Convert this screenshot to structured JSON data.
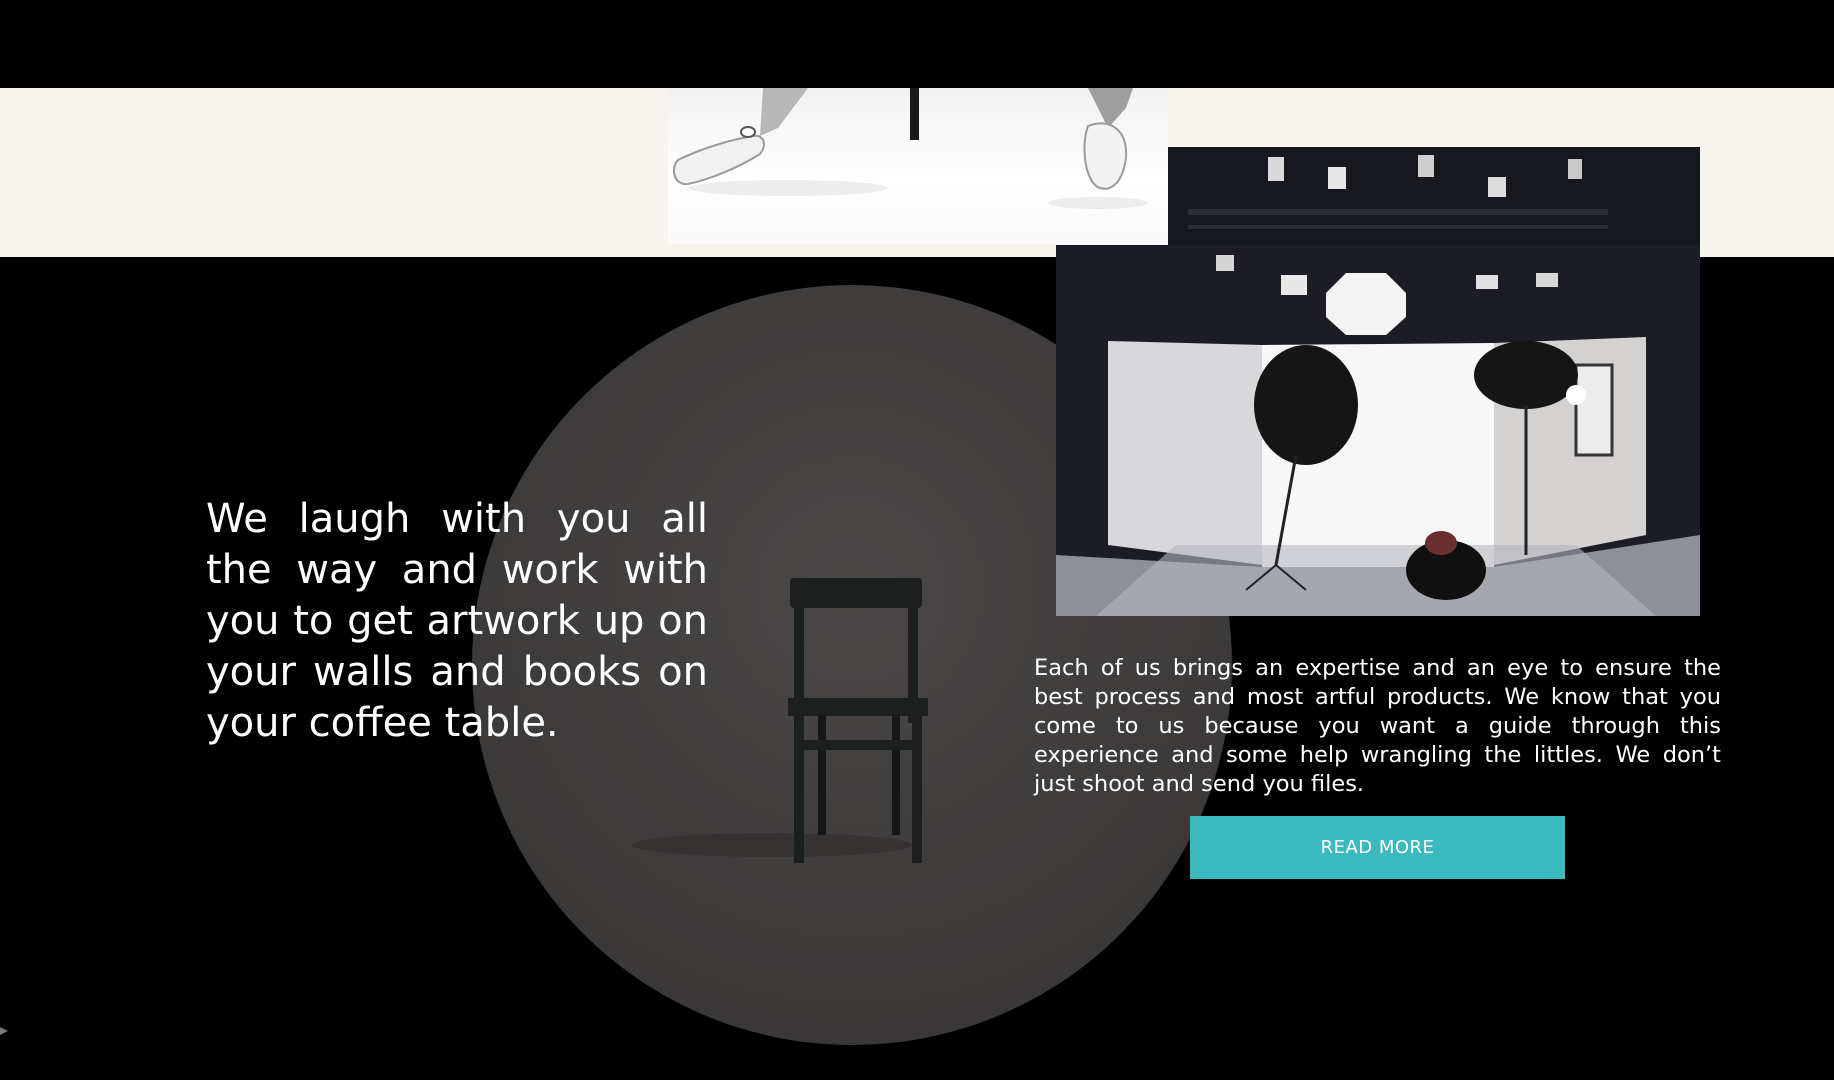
{
  "section": {
    "headline": "We laugh with you all the way and work with you to get artwork up on your walls and books on your coffee table.",
    "body": "Each of us brings an expertise and an eye to ensure the best process and most artful products. We know that you come to us because you want a guide through this experience and some help wrangling the littles. We don’t just shoot and send you files.",
    "read_more_label": "READ MORE"
  },
  "colors": {
    "background": "#000000",
    "cream_band": "#f6f4ec",
    "circle": "#3e3c3b",
    "button": "#3bb9be",
    "text": "#ffffff"
  },
  "images": {
    "top_photo": "legs-and-chair-photo",
    "circle_photo": "wooden-chair-photo",
    "studio_photo": "photo-studio-photo"
  }
}
